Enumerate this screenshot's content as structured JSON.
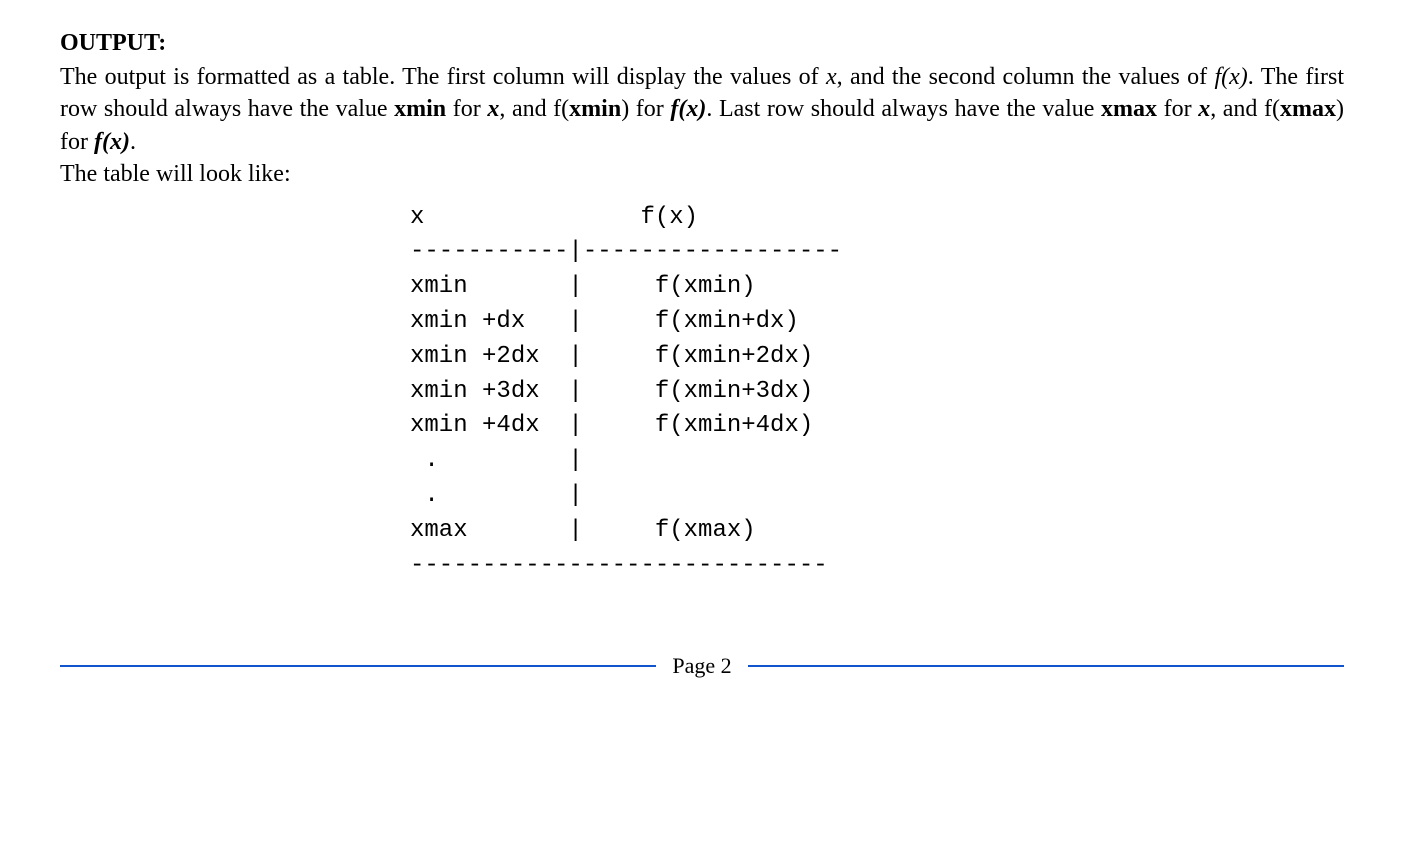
{
  "heading": "OUTPUT:",
  "p1_a": "The output is formatted as a table. The first column will display the values of ",
  "p1_x": "x",
  "p1_b": ", and the second column the values of ",
  "p1_fx": "f(x)",
  "p1_c": ". The first row should always have the value ",
  "p1_xmin": "xmin",
  "p1_d": " for ",
  "p1_xvar": "x",
  "p1_e": ", and f(",
  "p1_xmin2": "xmin",
  "p1_f": ") for ",
  "p1_fx2": "f(x)",
  "p1_g": ". Last row should always have the value ",
  "p1_xmax": "xmax",
  "p1_h": " for ",
  "p1_xvar2": "x",
  "p1_i": ", and f(",
  "p1_xmax2": "xmax",
  "p1_j": ") for ",
  "p1_fx3": "f(x)",
  "p1_k": ".",
  "p2": "The table will look like:",
  "table_lines": [
    "x               f(x)",
    "-----------|------------------",
    "xmin       |     f(xmin)",
    "xmin +dx   |     f(xmin+dx)",
    "xmin +2dx  |     f(xmin+2dx)",
    "xmin +3dx  |     f(xmin+3dx)",
    "xmin +4dx  |     f(xmin+4dx)",
    " .         |",
    " .         |",
    "xmax       |     f(xmax)",
    "-----------------------------"
  ],
  "page_label": "Page 2"
}
